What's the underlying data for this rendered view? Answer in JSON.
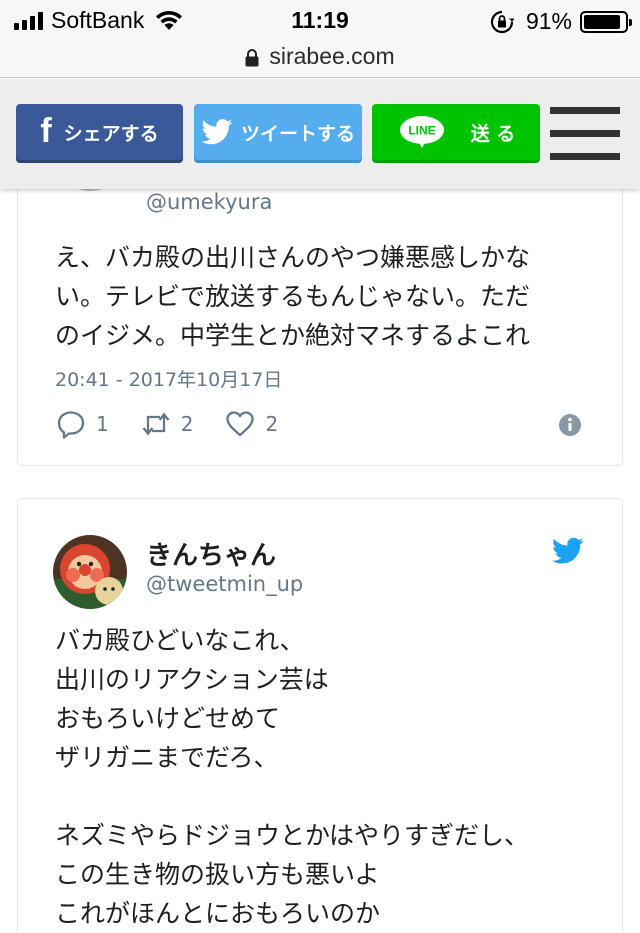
{
  "status_bar": {
    "carrier": "SoftBank",
    "time": "11:19",
    "battery_percent": "91%",
    "battery_level": 0.91
  },
  "url_bar": {
    "domain": "sirabee.com"
  },
  "share_bar": {
    "facebook_label": "シェアする",
    "facebook_icon": "f",
    "twitter_label": "ツイートする",
    "line_label": "送 る",
    "line_logo_text": "LINE",
    "colors": {
      "facebook": "#3b5998",
      "twitter": "#55acee",
      "line": "#00c300"
    }
  },
  "tweets": [
    {
      "handle": "@umekyura",
      "text": "え、バカ殿の出川さんのやつ嫌悪感しかな\nい。テレビで放送するもんじゃない。ただ\nのイジメ。中学生とか絶対マネするよこれ",
      "timestamp": "20:41 - 2017年10月17日",
      "replies": "1",
      "retweets": "2",
      "likes": "2"
    },
    {
      "display_name": "きんちゃん",
      "handle": "@tweetmin_up",
      "text": "バカ殿ひどいなこれ、\n出川のリアクション芸は\nおもろいけどせめて\nザリガニまでだろ、\n\nネズミやらドジョウとかはやりすぎだし、\nこの生き物の扱い方も悪いよ\nこれがほんとにおもろいのか"
    }
  ]
}
